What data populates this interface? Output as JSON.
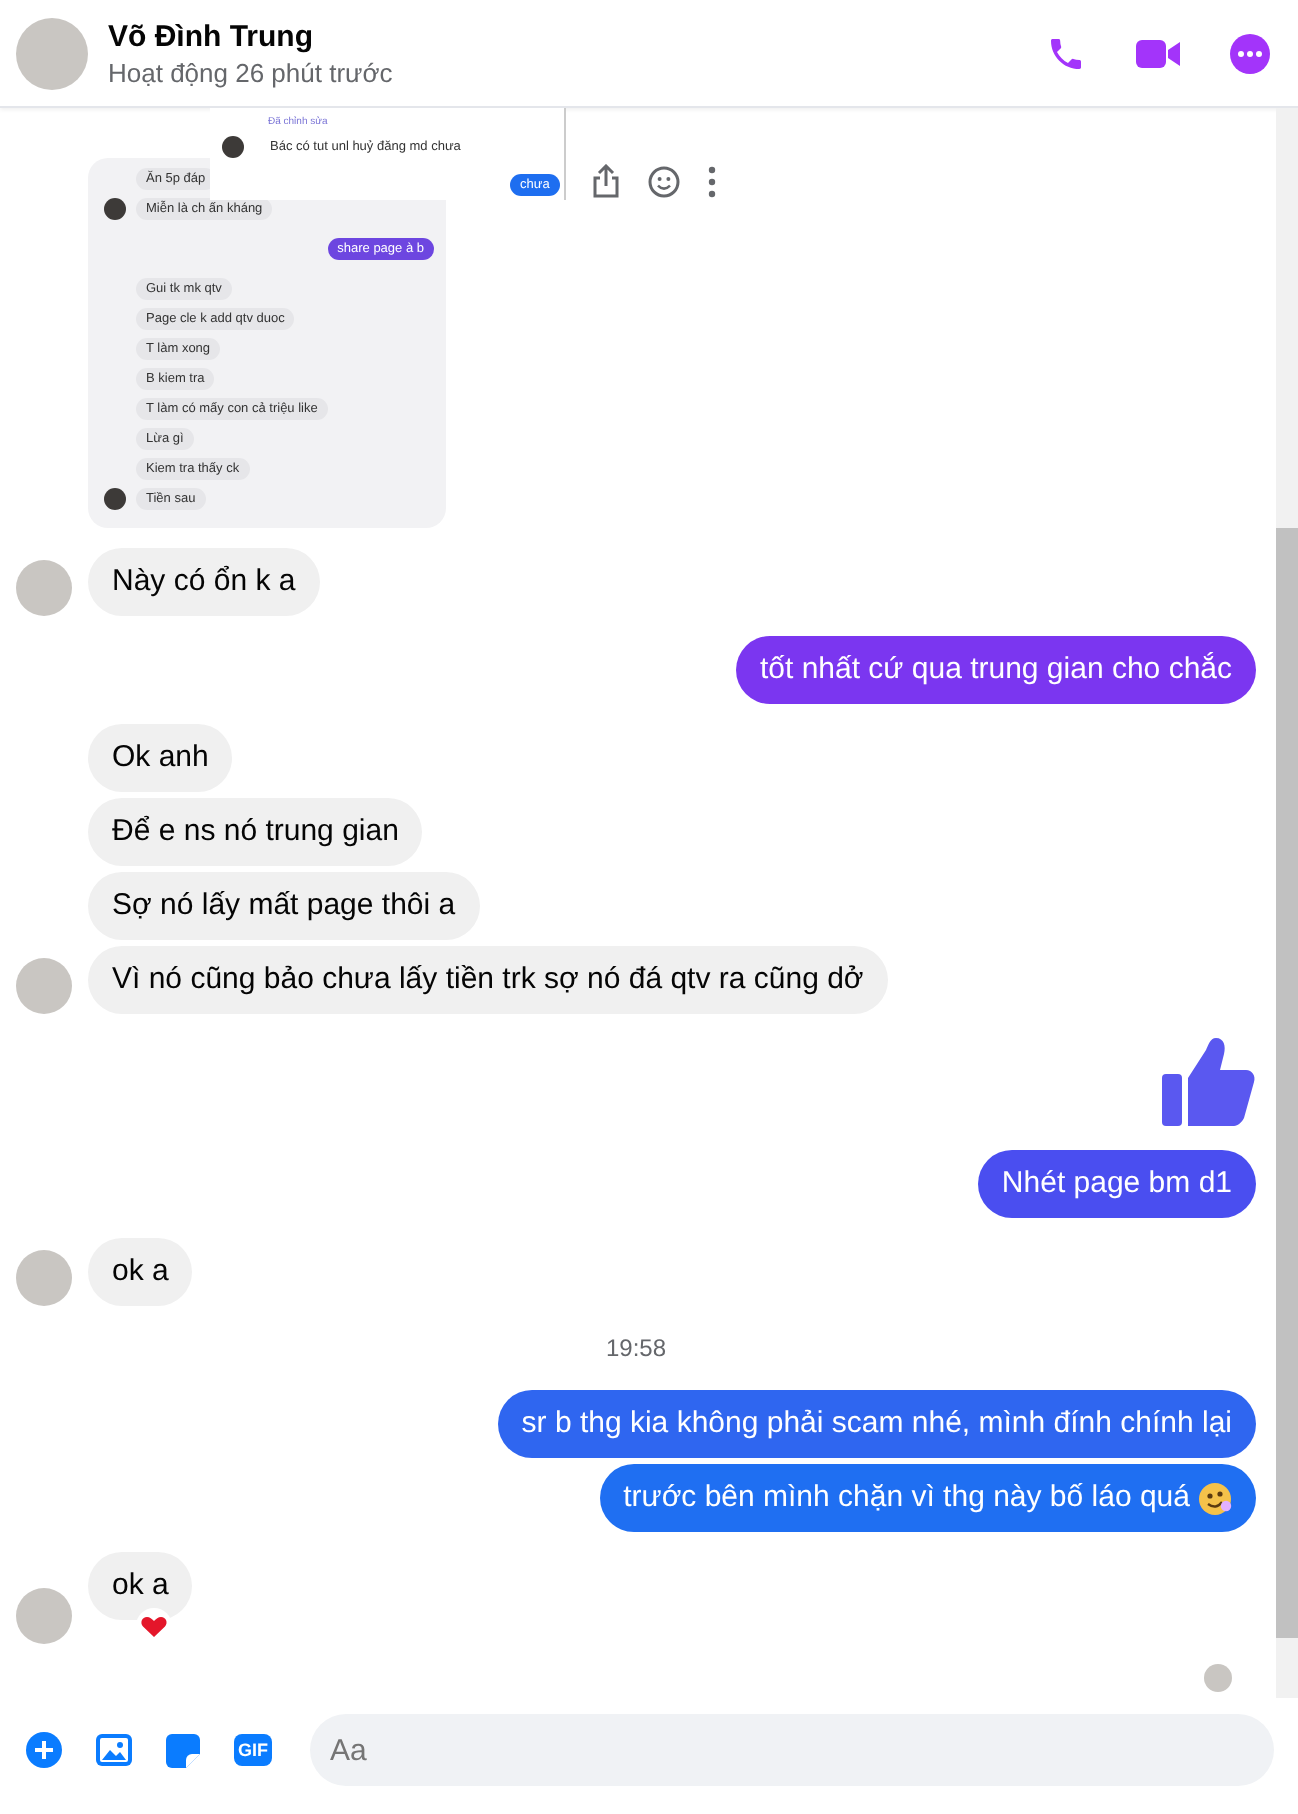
{
  "header": {
    "name": "Võ Đình Trung",
    "status": "Hoạt động 26 phút trước"
  },
  "attachment": {
    "pasted": {
      "edited_label": "Đã chỉnh sửa",
      "message": "Bác có tut unl huỷ đăng md chưa",
      "reply": "chưa"
    },
    "messages": [
      {
        "kind": "in",
        "text": "Ăn 5p đáp",
        "avatar": false
      },
      {
        "kind": "in",
        "text": "Miễn là  ch ấn kháng",
        "avatar": true
      },
      {
        "kind": "out",
        "text": "share page à b"
      },
      {
        "kind": "in",
        "text": "Gui tk mk qtv",
        "avatar": false
      },
      {
        "kind": "in",
        "text": "Page cle k add qtv duoc",
        "avatar": false
      },
      {
        "kind": "in",
        "text": "T làm xong",
        "avatar": false
      },
      {
        "kind": "in",
        "text": "B kiem tra",
        "avatar": false
      },
      {
        "kind": "in",
        "text": "T làm có mấy con cả triệu like",
        "avatar": false
      },
      {
        "kind": "in",
        "text": "Lừa gì",
        "avatar": false
      },
      {
        "kind": "in",
        "text": "Kiem tra thấy ck",
        "avatar": false
      },
      {
        "kind": "in",
        "text": "Tiền sau",
        "avatar": true
      }
    ]
  },
  "messages": [
    {
      "kind": "in",
      "text": "Này có ổn k a",
      "avatar": true,
      "reacted": false
    },
    {
      "kind": "out",
      "text": "tốt nhất cứ qua trung gian cho chắc",
      "color": "#7b36f0",
      "emoji": false
    },
    {
      "kind": "in",
      "text": "Ok anh",
      "avatar": false,
      "reacted": false
    },
    {
      "kind": "in",
      "text": "Để e ns nó trung gian",
      "avatar": false,
      "reacted": false
    },
    {
      "kind": "in",
      "text": "Sợ nó lấy mất page thôi a",
      "avatar": false,
      "reacted": false
    },
    {
      "kind": "in",
      "text": "Vì nó cũng bảo chưa lấy tiền trk sợ nó đá qtv ra cũng dở",
      "avatar": true,
      "reacted": false
    },
    {
      "kind": "like",
      "color": "#5a58f0"
    },
    {
      "kind": "out",
      "text": "Nhét page bm d1",
      "color": "#4a4ef0",
      "emoji": false
    },
    {
      "kind": "in",
      "text": "ok a",
      "avatar": true,
      "reacted": false
    },
    {
      "kind": "time",
      "text": "19:58"
    },
    {
      "kind": "out",
      "text": "sr b thg kia không phải scam nhé, mình đính chính lại",
      "color": "#2f66f0",
      "emoji": false
    },
    {
      "kind": "out",
      "text": "trước bên mình chặn vì thg này bố láo quá",
      "color": "#1f6ff2",
      "emoji": true
    },
    {
      "kind": "in",
      "text": "ok a",
      "avatar": true,
      "reacted": true
    }
  ],
  "composer": {
    "gif_label": "GIF",
    "placeholder": "Aa"
  }
}
